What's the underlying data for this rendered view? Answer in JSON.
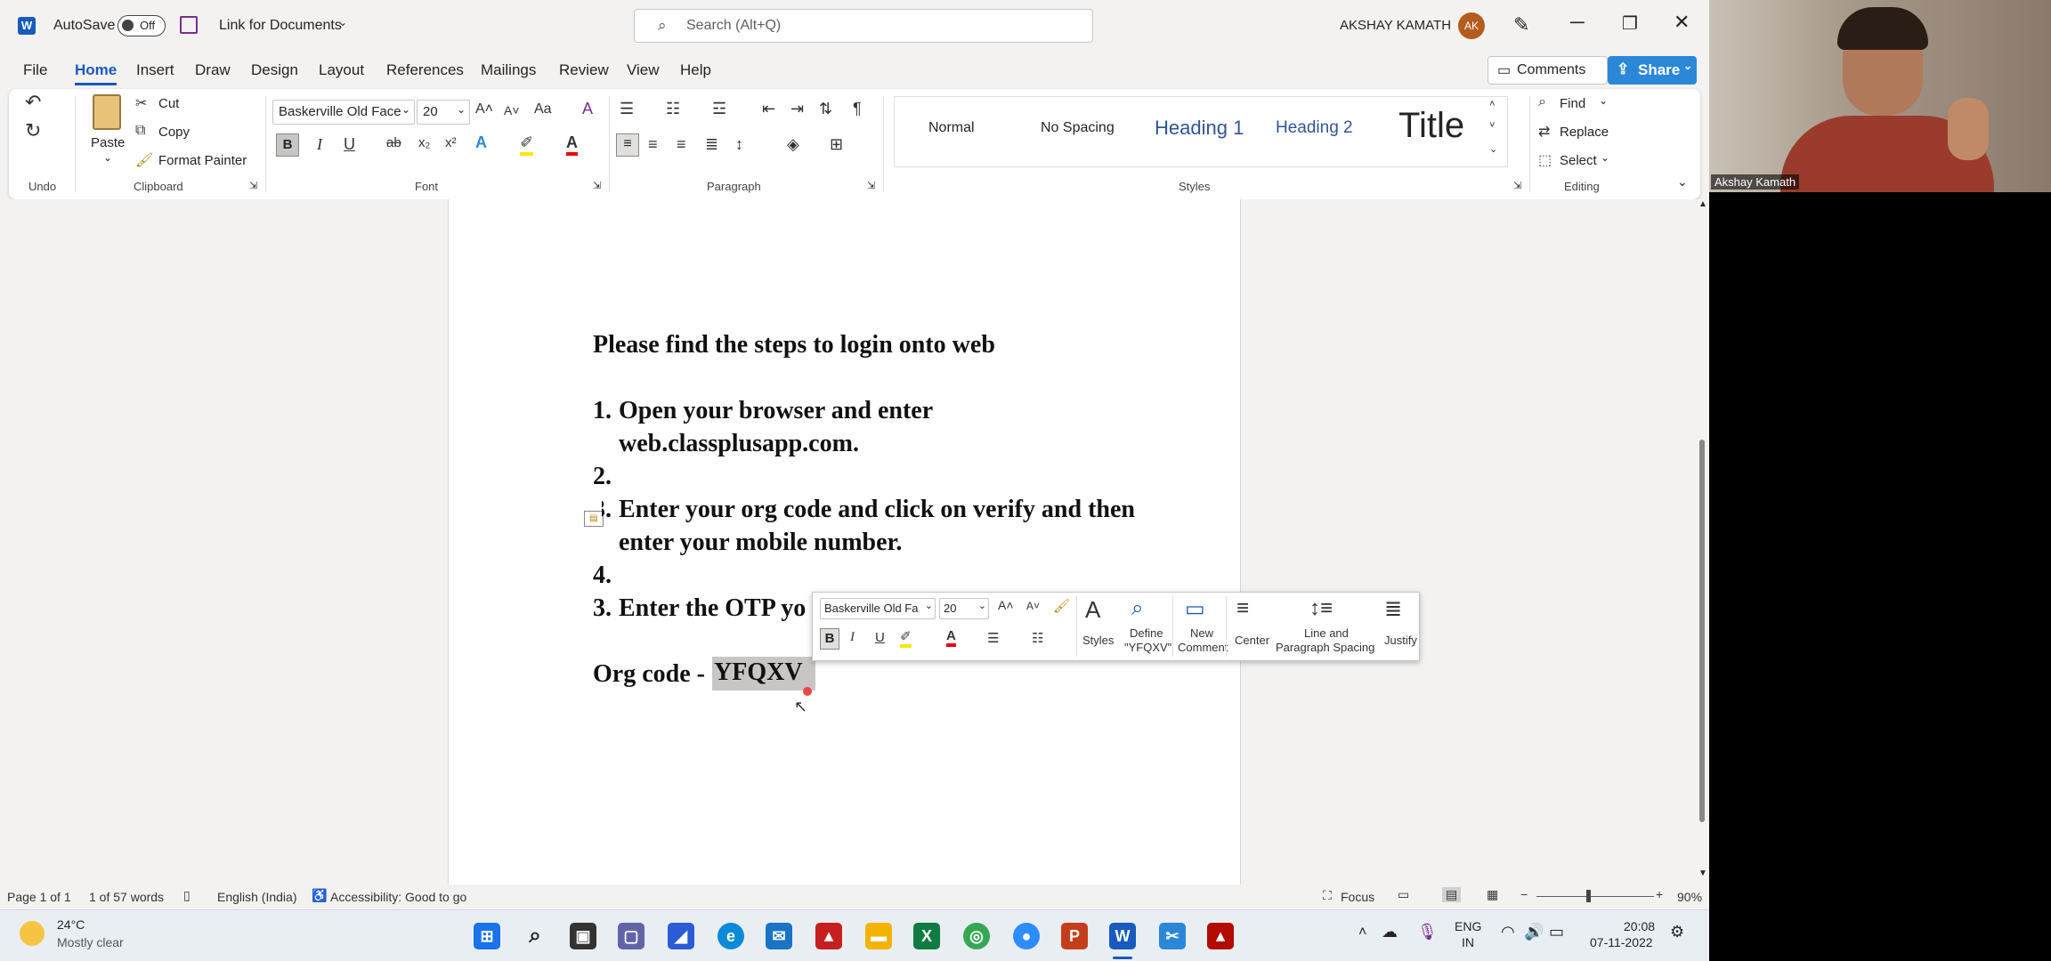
{
  "titlebar": {
    "autosave_label": "AutoSave",
    "autosave_state": "Off",
    "doc_title": "Link for Documents",
    "search_placeholder": "Search (Alt+Q)",
    "user_name": "AKSHAY KAMATH",
    "user_initials": "AK"
  },
  "menu": {
    "file": "File",
    "home": "Home",
    "insert": "Insert",
    "draw": "Draw",
    "design": "Design",
    "layout": "Layout",
    "references": "References",
    "mailings": "Mailings",
    "review": "Review",
    "view": "View",
    "help": "Help",
    "comments": "Comments",
    "share": "Share"
  },
  "ribbon": {
    "undo_group": "Undo",
    "paste": "Paste",
    "cut": "Cut",
    "copy": "Copy",
    "format_painter": "Format Painter",
    "clipboard_group": "Clipboard",
    "font_name": "Baskerville Old Face",
    "font_size": "20",
    "font_group": "Font",
    "paragraph_group": "Paragraph",
    "styles": [
      "Normal",
      "No Spacing",
      "Heading 1",
      "Heading 2",
      "Title"
    ],
    "styles_group": "Styles",
    "find": "Find",
    "replace": "Replace",
    "select": "Select",
    "editing_group": "Editing"
  },
  "document": {
    "line1": "Please find the steps to login onto web",
    "item1_num": "1.",
    "item1_a": "Open your browser and enter",
    "item1_b": "web.classplusapp.com.",
    "item2_num": "2.",
    "item3_num": "3.",
    "item3_a": "Enter your org code and click on verify and then",
    "item3_b": "enter your mobile number.",
    "item4_num": "4.",
    "item5_num": "3.",
    "item5_a": "Enter the OTP yo",
    "orgcode_label": "Org code - ",
    "orgcode_value": "YFQXV"
  },
  "minitoolbar": {
    "font_name": "Baskerville Old Fa",
    "font_size": "20",
    "styles": "Styles",
    "define_1": "Define",
    "define_2": "\"YFQXV\"",
    "new_comment_1": "New",
    "new_comment_2": "Comment",
    "center": "Center",
    "line_spacing_1": "Line and",
    "line_spacing_2": "Paragraph Spacing",
    "justify": "Justify"
  },
  "statusbar": {
    "page": "Page 1 of 1",
    "words": "1 of 57 words",
    "language": "English (India)",
    "accessibility": "Accessibility: Good to go",
    "focus": "Focus",
    "zoom": "90%"
  },
  "taskbar": {
    "temp": "24°C",
    "weather": "Mostly clear",
    "lang1": "ENG",
    "lang2": "IN",
    "time": "20:08",
    "date": "07-11-2022"
  },
  "video": {
    "participant": "Akshay Kamath"
  },
  "colors": {
    "accent": "#185abd",
    "share": "#2b88d8",
    "highlight": "#c8c6c4"
  }
}
